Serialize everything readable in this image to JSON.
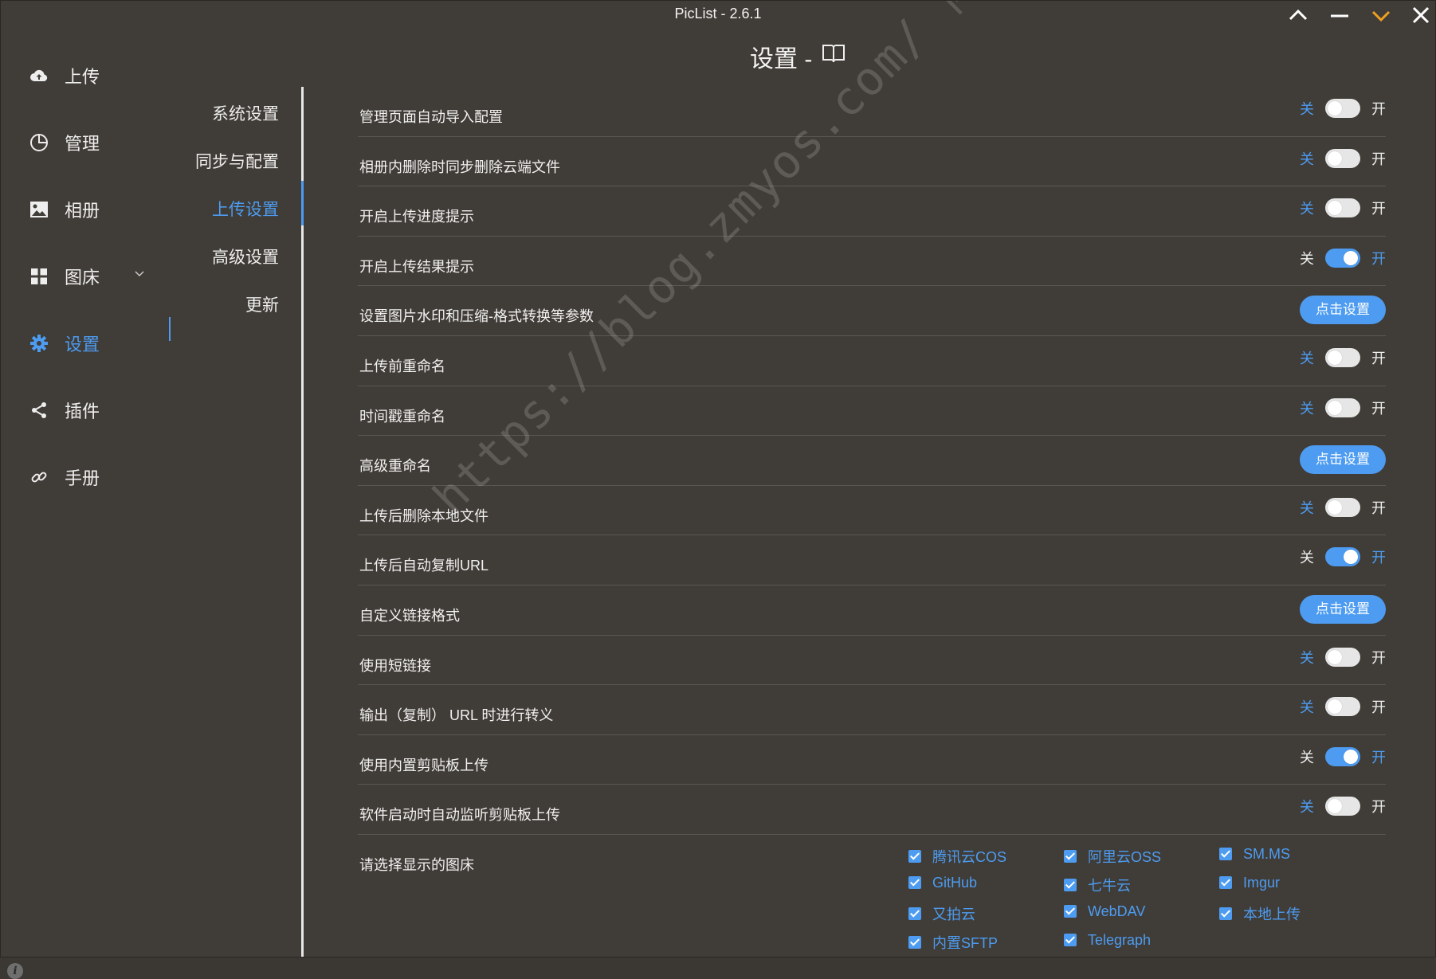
{
  "window": {
    "title": "PicList - 2.6.1"
  },
  "sidebar": {
    "items": [
      {
        "label": "上传",
        "icon": "cloud-upload-icon"
      },
      {
        "label": "管理",
        "icon": "pie-chart-icon"
      },
      {
        "label": "相册",
        "icon": "image-icon"
      },
      {
        "label": "图床",
        "icon": "grid-icon"
      },
      {
        "label": "设置",
        "icon": "gear-icon"
      },
      {
        "label": "插件",
        "icon": "share-icon"
      },
      {
        "label": "手册",
        "icon": "link-icon"
      }
    ],
    "active": "设置"
  },
  "subnav": {
    "items": [
      "系统设置",
      "同步与配置",
      "上传设置",
      "高级设置",
      "更新"
    ],
    "active": "上传设置"
  },
  "header": {
    "title": "设置 -"
  },
  "switch_labels": {
    "off": "关",
    "on": "开"
  },
  "settings": [
    {
      "label": "管理页面自动导入配置",
      "type": "switch",
      "on": false
    },
    {
      "label": "相册内删除时同步删除云端文件",
      "type": "switch",
      "on": false
    },
    {
      "label": "开启上传进度提示",
      "type": "switch",
      "on": false
    },
    {
      "label": "开启上传结果提示",
      "type": "switch",
      "on": true
    },
    {
      "label": "设置图片水印和压缩-格式转换等参数",
      "type": "button",
      "button": "点击设置"
    },
    {
      "label": "上传前重命名",
      "type": "switch",
      "on": false
    },
    {
      "label": "时间戳重命名",
      "type": "switch",
      "on": false
    },
    {
      "label": "高级重命名",
      "type": "button",
      "button": "点击设置"
    },
    {
      "label": "上传后删除本地文件",
      "type": "switch",
      "on": false
    },
    {
      "label": "上传后自动复制URL",
      "type": "switch",
      "on": true
    },
    {
      "label": "自定义链接格式",
      "type": "button",
      "button": "点击设置"
    },
    {
      "label": "使用短链接",
      "type": "switch",
      "on": false
    },
    {
      "label": "输出（复制） URL 时进行转义",
      "type": "switch",
      "on": false
    },
    {
      "label": "使用内置剪贴板上传",
      "type": "switch",
      "on": true
    },
    {
      "label": "软件启动时自动监听剪贴板上传",
      "type": "switch",
      "on": false
    }
  ],
  "picbeds": {
    "label": "请选择显示的图床",
    "items": [
      {
        "name": "腾讯云COS",
        "checked": true
      },
      {
        "name": "阿里云OSS",
        "checked": true
      },
      {
        "name": "SM.MS",
        "checked": true
      },
      {
        "name": "GitHub",
        "checked": true
      },
      {
        "name": "七牛云",
        "checked": true
      },
      {
        "name": "Imgur",
        "checked": true
      },
      {
        "name": "又拍云",
        "checked": true
      },
      {
        "name": "WebDAV",
        "checked": true
      },
      {
        "name": "本地上传",
        "checked": true
      },
      {
        "name": "内置SFTP",
        "checked": true
      },
      {
        "name": "Telegraph",
        "checked": true
      }
    ]
  },
  "watermark": "https://blog.zmyos.com/ 博客-hubk",
  "colors": {
    "accent": "#4d9cf1",
    "background": "#403c37",
    "orange": "#f0a020"
  }
}
